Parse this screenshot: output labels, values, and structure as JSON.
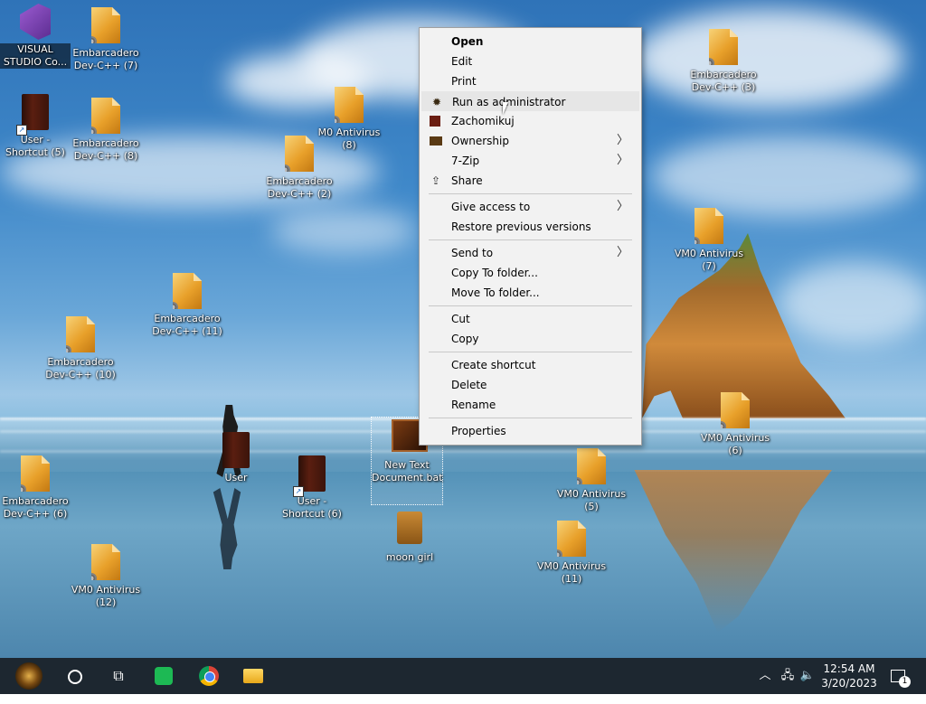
{
  "desktop": {
    "icons": [
      {
        "label": "VISUAL STUDIO Co..."
      },
      {
        "label": "Embarcadero Dev-C++ (7)"
      },
      {
        "label": "User - Shortcut (5)"
      },
      {
        "label": "Embarcadero Dev-C++ (8)"
      },
      {
        "label": "M0 Antivirus (8)"
      },
      {
        "label": "Embarcadero Dev-C++ (2)"
      },
      {
        "label": "Embarcadero Dev-C++ (11)"
      },
      {
        "label": "Embarcadero Dev-C++ (10)"
      },
      {
        "label": "User"
      },
      {
        "label": "User - Shortcut (6)"
      },
      {
        "label": "New Text Document.bat"
      },
      {
        "label": "moon girl"
      },
      {
        "label": "Embarcadero Dev-C++ (6)"
      },
      {
        "label": "VM0 Antivirus (12)"
      },
      {
        "label": "Embarcadero Dev-C++ (3)"
      },
      {
        "label": "VM0 Antivirus (7)"
      },
      {
        "label": "VM0 Antivirus (6)"
      },
      {
        "label": "VM0 Antivirus (5)"
      },
      {
        "label": "VM0 Antivirus (11)"
      }
    ]
  },
  "context_menu": {
    "open": "Open",
    "edit": "Edit",
    "print": "Print",
    "run_as_admin": "Run as administrator",
    "zachomikuj": "Zachomikuj",
    "ownership": "Ownership",
    "seven_zip": "7-Zip",
    "share": "Share",
    "give_access": "Give access to",
    "restore_versions": "Restore previous versions",
    "send_to": "Send to",
    "copy_to_folder": "Copy To folder...",
    "move_to_folder": "Move To folder...",
    "cut": "Cut",
    "copy": "Copy",
    "create_shortcut": "Create shortcut",
    "delete": "Delete",
    "rename": "Rename",
    "properties": "Properties"
  },
  "taskbar": {
    "clock_time": "12:54 AM",
    "clock_date": "3/20/2023",
    "notification_count": "1"
  },
  "colors": {
    "taskbar_bg": "#1d2730",
    "menu_bg": "#f2f2f2",
    "menu_hover": "#e6e6e6"
  }
}
